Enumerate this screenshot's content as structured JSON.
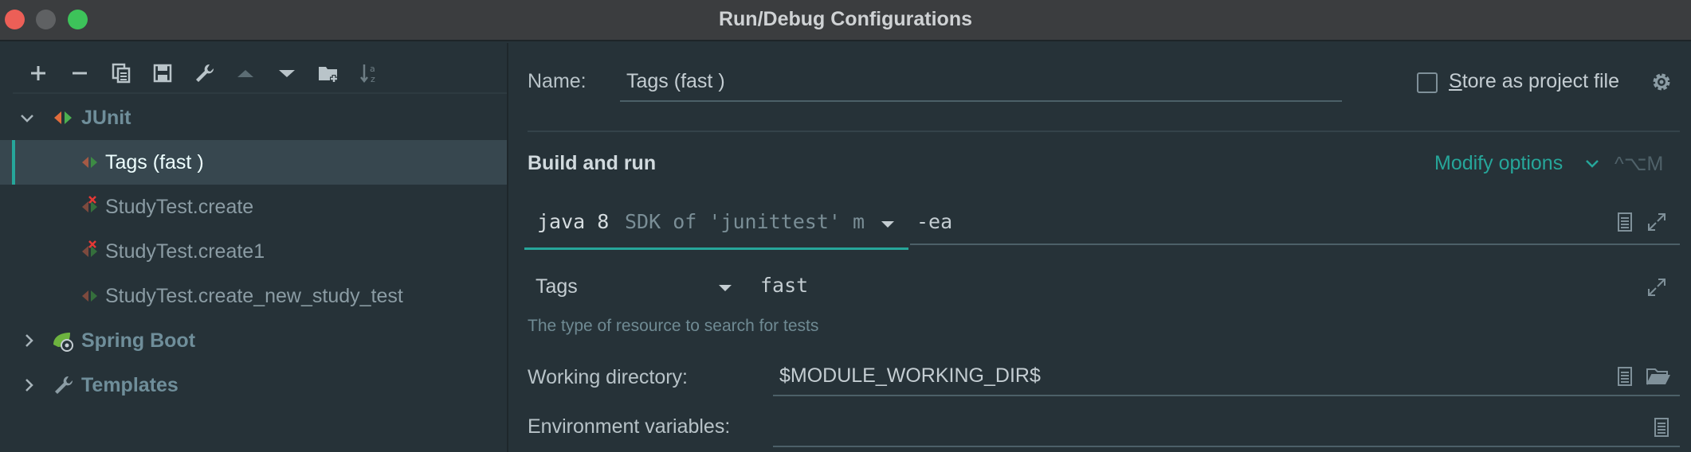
{
  "window": {
    "title": "Run/Debug Configurations"
  },
  "toolbar": {
    "buttons": [
      {
        "icon": "plus-icon"
      },
      {
        "icon": "minus-icon"
      },
      {
        "icon": "copy-icon"
      },
      {
        "icon": "save-icon"
      },
      {
        "icon": "wrench-icon"
      },
      {
        "icon": "arrow-up-icon"
      },
      {
        "icon": "arrow-down-icon"
      },
      {
        "icon": "new-folder-icon"
      },
      {
        "icon": "sort-alpha-icon"
      }
    ]
  },
  "tree": {
    "junit": {
      "label": "JUnit",
      "expanded": true
    },
    "items": [
      {
        "label": "Tags (fast )",
        "selected": true,
        "error": false
      },
      {
        "label": "StudyTest.create",
        "selected": false,
        "error": true
      },
      {
        "label": "StudyTest.create1",
        "selected": false,
        "error": true
      },
      {
        "label": "StudyTest.create_new_study_test",
        "selected": false,
        "error": false
      }
    ],
    "spring_boot": {
      "label": "Spring Boot",
      "expanded": false
    },
    "templates": {
      "label": "Templates",
      "expanded": false
    }
  },
  "config": {
    "name_label": "Name:",
    "name_value": "Tags (fast )",
    "store_label_prefix": "S",
    "store_label_rest": "tore as project file",
    "store_checked": false,
    "build_run_title": "Build and run",
    "modify_options": "Modify options",
    "modify_shortcut": "^⌥M",
    "jre_version": "java 8",
    "jre_detail": "SDK of 'junittest' m",
    "vm_options": "-ea",
    "test_kind": "Tags",
    "tag_expression": "fast",
    "tag_hint": "The type of resource to search for tests",
    "working_dir_label": "Working directory:",
    "working_dir_value": "$MODULE_WORKING_DIR$",
    "env_vars_label": "Environment variables:",
    "env_vars_value": ""
  },
  "colors": {
    "accent": "#26a69a",
    "background": "#263238",
    "selection": "#37474f",
    "error": "#e53935"
  }
}
